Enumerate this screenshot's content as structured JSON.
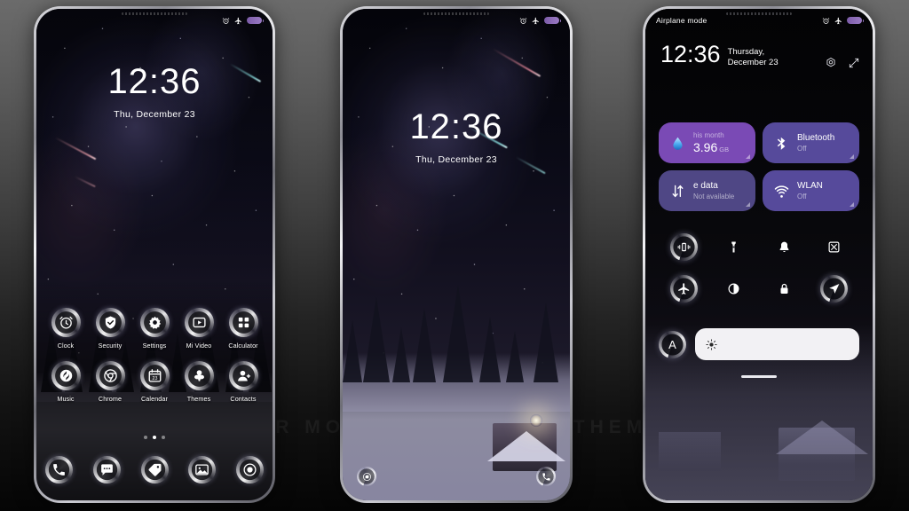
{
  "watermark": "VISIT  FOR  MORE  THEMES  MIUITHEMER.COM",
  "phone1": {
    "name": "home-screen",
    "statusbar": {
      "alarm_icon": "alarm-icon",
      "airplane_icon": "airplane-icon",
      "battery_icon": "battery-icon"
    },
    "clock": {
      "time": "12:36",
      "date": "Thu, December 23"
    },
    "apps": [
      {
        "label": "Clock",
        "icon": "clock-icon"
      },
      {
        "label": "Security",
        "icon": "shield-icon"
      },
      {
        "label": "Settings",
        "icon": "gear-icon"
      },
      {
        "label": "Mi Video",
        "icon": "play-icon"
      },
      {
        "label": "Calculator",
        "icon": "calculator-icon"
      },
      {
        "label": "Music",
        "icon": "music-icon"
      },
      {
        "label": "Chrome",
        "icon": "chrome-icon"
      },
      {
        "label": "Calendar",
        "icon": "calendar-icon"
      },
      {
        "label": "Themes",
        "icon": "themes-icon"
      },
      {
        "label": "Contacts",
        "icon": "contacts-icon"
      }
    ],
    "pages": {
      "count": 3,
      "active": 1
    },
    "dock": [
      {
        "label": "Phone",
        "icon": "phone-icon"
      },
      {
        "label": "Messages",
        "icon": "message-icon"
      },
      {
        "label": "Market",
        "icon": "tag-icon"
      },
      {
        "label": "Gallery",
        "icon": "gallery-icon"
      },
      {
        "label": "Camera",
        "icon": "camera-icon"
      }
    ]
  },
  "phone2": {
    "name": "lock-screen",
    "statusbar": {
      "alarm_icon": "alarm-icon",
      "airplane_icon": "airplane-icon",
      "battery_icon": "battery-icon"
    },
    "clock": {
      "time": "12:36",
      "date": "Thu, December 23"
    },
    "shortcuts": [
      {
        "label": "Camera",
        "icon": "camera-icon"
      },
      {
        "label": "Phone",
        "icon": "phone-icon"
      }
    ]
  },
  "phone3": {
    "name": "control-center",
    "statusbar": {
      "airplane_mode_label": "Airplane mode",
      "alarm_icon": "alarm-icon",
      "airplane_icon": "airplane-icon",
      "battery_icon": "battery-icon"
    },
    "header": {
      "time": "12:36",
      "date": "Thursday, December 23",
      "settings_icon": "gear-icon",
      "edit_icon": "edit-icon"
    },
    "tiles": [
      {
        "id": "data-usage",
        "kind": "usage",
        "top": "his month",
        "value": "3.96",
        "unit": "GB",
        "icon": "water-drop-icon",
        "color": "#7A4AB5"
      },
      {
        "id": "bluetooth",
        "kind": "toggle",
        "title": "Bluetooth",
        "sub": "Off",
        "icon": "bluetooth-icon",
        "color": "#564A9B"
      },
      {
        "id": "mobile-data",
        "kind": "toggle",
        "title": "e data",
        "sub": "Not available",
        "icon": "data-transfer-icon",
        "color": "#4F4785"
      },
      {
        "id": "wlan",
        "kind": "toggle",
        "title": "WLAN",
        "sub": "Off",
        "icon": "wifi-icon",
        "color": "#564A9B"
      }
    ],
    "toggles": [
      {
        "id": "vibrate",
        "icon": "vibrate-icon",
        "active": true
      },
      {
        "id": "flashlight",
        "icon": "flashlight-icon",
        "active": false
      },
      {
        "id": "ringer",
        "icon": "bell-icon",
        "active": false
      },
      {
        "id": "screenshot",
        "icon": "screenshot-icon",
        "active": false
      },
      {
        "id": "airplane",
        "icon": "airplane-icon",
        "active": true
      },
      {
        "id": "dark-mode",
        "icon": "contrast-icon",
        "active": false
      },
      {
        "id": "lock",
        "icon": "lock-icon",
        "active": false
      },
      {
        "id": "location",
        "icon": "location-icon",
        "active": true
      }
    ],
    "brightness": {
      "auto_label": "A",
      "icon": "brightness-icon",
      "level": 0
    }
  },
  "colors": {
    "accent_magenta": "#7A4AB5",
    "accent_violet": "#564A9B",
    "slider_bg": "#F2F1F4",
    "text_white": "#FFFFFF"
  }
}
